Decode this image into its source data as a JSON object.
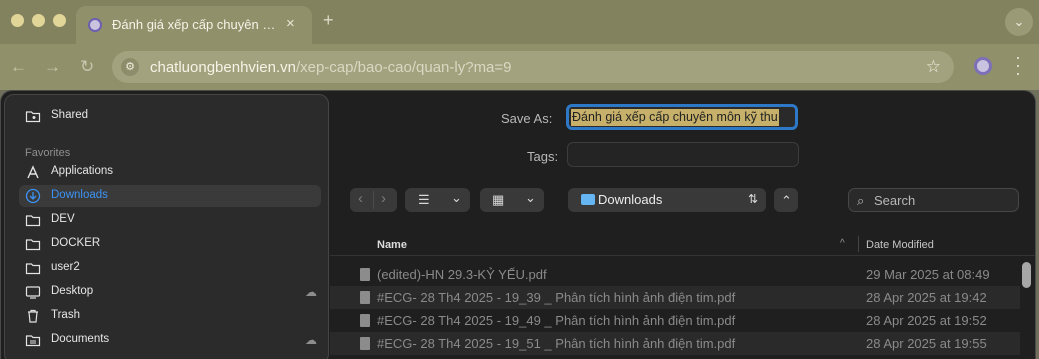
{
  "browser": {
    "tab_title": "Đánh giá xếp cấp chuyên môn",
    "tab_close": "×",
    "new_tab": "+",
    "url_host": "chatluongbenhvien.vn",
    "url_path": "/xep-cap/bao-cao/quan-ly?ma=9",
    "nav_back": "←",
    "nav_forward": "→",
    "nav_reload": "↻",
    "star": "☆",
    "site_settings": "⚙"
  },
  "dialog": {
    "save_as_label": "Save As:",
    "save_as_value": "Đánh giá xếp cấp chuyên môn kỹ thu",
    "tags_label": "Tags:",
    "tags_value": "",
    "view_list_icon": "☰",
    "view_grid_icon": "▦",
    "chevron": "⌄",
    "location": "Downloads",
    "location_arrows": "⇅",
    "expand": "⌃",
    "search_placeholder": "Search",
    "search_icon": "⌕"
  },
  "sidebar": {
    "top_items": [
      {
        "label": "Shared",
        "icon": "shared-folder-icon"
      }
    ],
    "favorites_title": "Favorites",
    "items": [
      {
        "label": "Applications",
        "icon": "applications-icon",
        "active": false,
        "cloud": false
      },
      {
        "label": "Downloads",
        "icon": "downloads-icon",
        "active": true,
        "cloud": false
      },
      {
        "label": "DEV",
        "icon": "folder-icon",
        "active": false,
        "cloud": false
      },
      {
        "label": "DOCKER",
        "icon": "folder-icon",
        "active": false,
        "cloud": false
      },
      {
        "label": "user2",
        "icon": "folder-icon",
        "active": false,
        "cloud": false
      },
      {
        "label": "Desktop",
        "icon": "desktop-icon",
        "active": false,
        "cloud": true
      },
      {
        "label": "Trash",
        "icon": "trash-icon",
        "active": false,
        "cloud": false
      },
      {
        "label": "Documents",
        "icon": "documents-icon",
        "active": false,
        "cloud": true
      }
    ],
    "cloud_glyph": "☁"
  },
  "file_list": {
    "columns": {
      "name": "Name",
      "date": "Date Modified"
    },
    "sort_glyph": "^",
    "rows": [
      {
        "name": "(edited)-HN 29.3-KỶ YẾU.pdf",
        "date": "29 Mar 2025 at 08:49"
      },
      {
        "name": "#ECG- 28 Th4 2025 - 19_39 _ Phân tích hình ảnh điện tim.pdf",
        "date": "28 Apr 2025 at 19:42"
      },
      {
        "name": "#ECG- 28 Th4 2025 - 19_49 _ Phân tích hình ảnh điện tim.pdf",
        "date": "28 Apr 2025 at 19:52"
      },
      {
        "name": "#ECG- 28 Th4 2025 - 19_51 _ Phân tích hình ảnh điện tim.pdf",
        "date": "28 Apr 2025 at 19:55"
      }
    ]
  },
  "colors": {
    "accent": "#3b93f5",
    "selection": "#c6b06a",
    "focus_ring": "#2d79c7"
  }
}
